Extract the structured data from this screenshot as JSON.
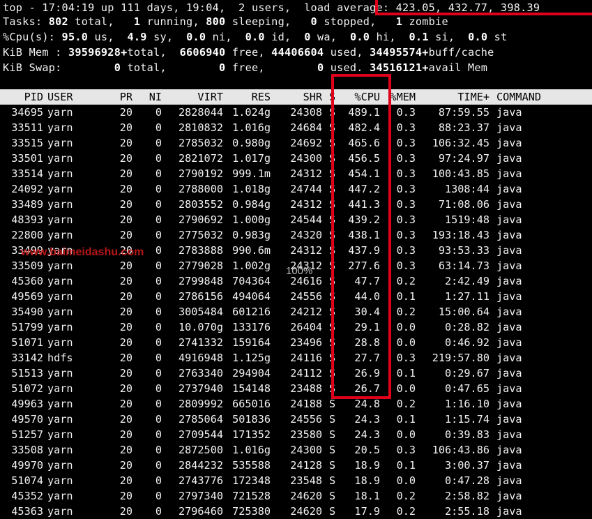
{
  "summary": {
    "line1a": "top - 17:04:19 up 111 days, 19:04,  2 users,  load a",
    "line1b": "verage: 423.05, 432.77, 398.39",
    "tasks": [
      "Tasks: ",
      "802",
      " total,   ",
      "1",
      " running, ",
      "800",
      " sleeping,   ",
      "0",
      " stopped,   ",
      "1",
      " zombie"
    ],
    "cpu": [
      "%Cpu(s): ",
      "95.0",
      " us,  ",
      "4.9",
      " sy,  ",
      "0.0",
      " ni,  ",
      "0.0",
      " id,  ",
      "0",
      " wa,  ",
      "0.0",
      " hi,  ",
      "0.1",
      " si,  ",
      "0.0",
      " st"
    ],
    "mem": [
      "KiB Mem : ",
      "39596928+",
      "total,  ",
      "6606940",
      " free, ",
      "44406604",
      " used, ",
      "34495574+",
      "buff/cache"
    ],
    "swap": [
      "KiB Swap:        ",
      "0",
      " total,        ",
      "0",
      " free,        ",
      "0",
      " used. ",
      "34516121+",
      "avail Mem"
    ]
  },
  "columns": {
    "pid": "PID",
    "user": "USER",
    "pr": "PR",
    "ni": "NI",
    "virt": "VIRT",
    "res": "RES",
    "shr": "SHR",
    "s": "S",
    "cpu": "%CPU",
    "mem": "%MEM",
    "time": "TIME+",
    "command": "COMMAND"
  },
  "processes": [
    {
      "pid": "34695",
      "user": "yarn",
      "pr": "20",
      "ni": "0",
      "virt": "2828044",
      "res": "1.024g",
      "shr": "24308",
      "s": "S",
      "cpu": "489.1",
      "mem": "0.3",
      "time": "87:59.55",
      "command": "java"
    },
    {
      "pid": "33511",
      "user": "yarn",
      "pr": "20",
      "ni": "0",
      "virt": "2810832",
      "res": "1.016g",
      "shr": "24684",
      "s": "S",
      "cpu": "482.4",
      "mem": "0.3",
      "time": "88:23.37",
      "command": "java"
    },
    {
      "pid": "33515",
      "user": "yarn",
      "pr": "20",
      "ni": "0",
      "virt": "2785032",
      "res": "0.980g",
      "shr": "24692",
      "s": "S",
      "cpu": "465.6",
      "mem": "0.3",
      "time": "106:32.45",
      "command": "java"
    },
    {
      "pid": "33501",
      "user": "yarn",
      "pr": "20",
      "ni": "0",
      "virt": "2821072",
      "res": "1.017g",
      "shr": "24300",
      "s": "S",
      "cpu": "456.5",
      "mem": "0.3",
      "time": "97:24.97",
      "command": "java"
    },
    {
      "pid": "33514",
      "user": "yarn",
      "pr": "20",
      "ni": "0",
      "virt": "2790192",
      "res": "999.1m",
      "shr": "24312",
      "s": "S",
      "cpu": "454.1",
      "mem": "0.3",
      "time": "100:43.85",
      "command": "java"
    },
    {
      "pid": "24092",
      "user": "yarn",
      "pr": "20",
      "ni": "0",
      "virt": "2788000",
      "res": "1.018g",
      "shr": "24744",
      "s": "S",
      "cpu": "447.2",
      "mem": "0.3",
      "time": "1308:44",
      "command": "java"
    },
    {
      "pid": "33489",
      "user": "yarn",
      "pr": "20",
      "ni": "0",
      "virt": "2803552",
      "res": "0.984g",
      "shr": "24312",
      "s": "S",
      "cpu": "441.3",
      "mem": "0.3",
      "time": "71:08.06",
      "command": "java"
    },
    {
      "pid": "48393",
      "user": "yarn",
      "pr": "20",
      "ni": "0",
      "virt": "2790692",
      "res": "1.000g",
      "shr": "24544",
      "s": "S",
      "cpu": "439.2",
      "mem": "0.3",
      "time": "1519:48",
      "command": "java"
    },
    {
      "pid": "22800",
      "user": "yarn",
      "pr": "20",
      "ni": "0",
      "virt": "2775032",
      "res": "0.983g",
      "shr": "24320",
      "s": "S",
      "cpu": "438.1",
      "mem": "0.3",
      "time": "193:18.43",
      "command": "java"
    },
    {
      "pid": "33499",
      "user": "yarn",
      "pr": "20",
      "ni": "0",
      "virt": "2783888",
      "res": "990.6m",
      "shr": "24312",
      "s": "S",
      "cpu": "437.9",
      "mem": "0.3",
      "time": "93:53.33",
      "command": "java"
    },
    {
      "pid": "33509",
      "user": "yarn",
      "pr": "20",
      "ni": "0",
      "virt": "2779028",
      "res": "1.002g",
      "shr": "24312",
      "s": "S",
      "cpu": "277.6",
      "mem": "0.3",
      "time": "63:14.73",
      "command": "java"
    },
    {
      "pid": "45360",
      "user": "yarn",
      "pr": "20",
      "ni": "0",
      "virt": "2799848",
      "res": "704364",
      "shr": "24616",
      "s": "S",
      "cpu": "47.7",
      "mem": "0.2",
      "time": "2:42.49",
      "command": "java"
    },
    {
      "pid": "49569",
      "user": "yarn",
      "pr": "20",
      "ni": "0",
      "virt": "2786156",
      "res": "494064",
      "shr": "24556",
      "s": "S",
      "cpu": "44.0",
      "mem": "0.1",
      "time": "1:27.11",
      "command": "java"
    },
    {
      "pid": "35490",
      "user": "yarn",
      "pr": "20",
      "ni": "0",
      "virt": "3005484",
      "res": "601216",
      "shr": "24212",
      "s": "S",
      "cpu": "30.4",
      "mem": "0.2",
      "time": "15:00.64",
      "command": "java"
    },
    {
      "pid": "51799",
      "user": "yarn",
      "pr": "20",
      "ni": "0",
      "virt": "10.070g",
      "res": "133176",
      "shr": "26404",
      "s": "S",
      "cpu": "29.1",
      "mem": "0.0",
      "time": "0:28.82",
      "command": "java"
    },
    {
      "pid": "51071",
      "user": "yarn",
      "pr": "20",
      "ni": "0",
      "virt": "2741332",
      "res": "159164",
      "shr": "23496",
      "s": "S",
      "cpu": "28.8",
      "mem": "0.0",
      "time": "0:46.92",
      "command": "java"
    },
    {
      "pid": "33142",
      "user": "hdfs",
      "pr": "20",
      "ni": "0",
      "virt": "4916948",
      "res": "1.125g",
      "shr": "24116",
      "s": "S",
      "cpu": "27.7",
      "mem": "0.3",
      "time": "219:57.80",
      "command": "java"
    },
    {
      "pid": "51513",
      "user": "yarn",
      "pr": "20",
      "ni": "0",
      "virt": "2763340",
      "res": "294904",
      "shr": "24112",
      "s": "S",
      "cpu": "26.9",
      "mem": "0.1",
      "time": "0:29.67",
      "command": "java"
    },
    {
      "pid": "51072",
      "user": "yarn",
      "pr": "20",
      "ni": "0",
      "virt": "2737940",
      "res": "154148",
      "shr": "23488",
      "s": "S",
      "cpu": "26.7",
      "mem": "0.0",
      "time": "0:47.65",
      "command": "java"
    },
    {
      "pid": "49963",
      "user": "yarn",
      "pr": "20",
      "ni": "0",
      "virt": "2809992",
      "res": "665016",
      "shr": "24188",
      "s": "S",
      "cpu": "24.8",
      "mem": "0.2",
      "time": "1:16.10",
      "command": "java"
    },
    {
      "pid": "49570",
      "user": "yarn",
      "pr": "20",
      "ni": "0",
      "virt": "2785064",
      "res": "501836",
      "shr": "24556",
      "s": "S",
      "cpu": "24.3",
      "mem": "0.1",
      "time": "1:15.74",
      "command": "java"
    },
    {
      "pid": "51257",
      "user": "yarn",
      "pr": "20",
      "ni": "0",
      "virt": "2709544",
      "res": "171352",
      "shr": "23580",
      "s": "S",
      "cpu": "24.3",
      "mem": "0.0",
      "time": "0:39.83",
      "command": "java"
    },
    {
      "pid": "33508",
      "user": "yarn",
      "pr": "20",
      "ni": "0",
      "virt": "2872500",
      "res": "1.016g",
      "shr": "24300",
      "s": "S",
      "cpu": "20.5",
      "mem": "0.3",
      "time": "106:43.86",
      "command": "java"
    },
    {
      "pid": "49970",
      "user": "yarn",
      "pr": "20",
      "ni": "0",
      "virt": "2844232",
      "res": "535588",
      "shr": "24128",
      "s": "S",
      "cpu": "18.9",
      "mem": "0.1",
      "time": "3:00.37",
      "command": "java"
    },
    {
      "pid": "51074",
      "user": "yarn",
      "pr": "20",
      "ni": "0",
      "virt": "2743776",
      "res": "172348",
      "shr": "23548",
      "s": "S",
      "cpu": "18.9",
      "mem": "0.0",
      "time": "0:47.28",
      "command": "java"
    },
    {
      "pid": "45352",
      "user": "yarn",
      "pr": "20",
      "ni": "0",
      "virt": "2797340",
      "res": "721528",
      "shr": "24620",
      "s": "S",
      "cpu": "18.1",
      "mem": "0.2",
      "time": "2:58.82",
      "command": "java"
    },
    {
      "pid": "45363",
      "user": "yarn",
      "pr": "20",
      "ni": "0",
      "virt": "2796460",
      "res": "725380",
      "shr": "24620",
      "s": "S",
      "cpu": "17.9",
      "mem": "0.2",
      "time": "2:55.18",
      "command": "java"
    }
  ],
  "overlay": {
    "watermark": "www.baimeidashu.com",
    "zoom": "100%"
  },
  "colors": {
    "highlight": "#e0001b",
    "background": "#000000",
    "text": "#f2f2f2"
  }
}
